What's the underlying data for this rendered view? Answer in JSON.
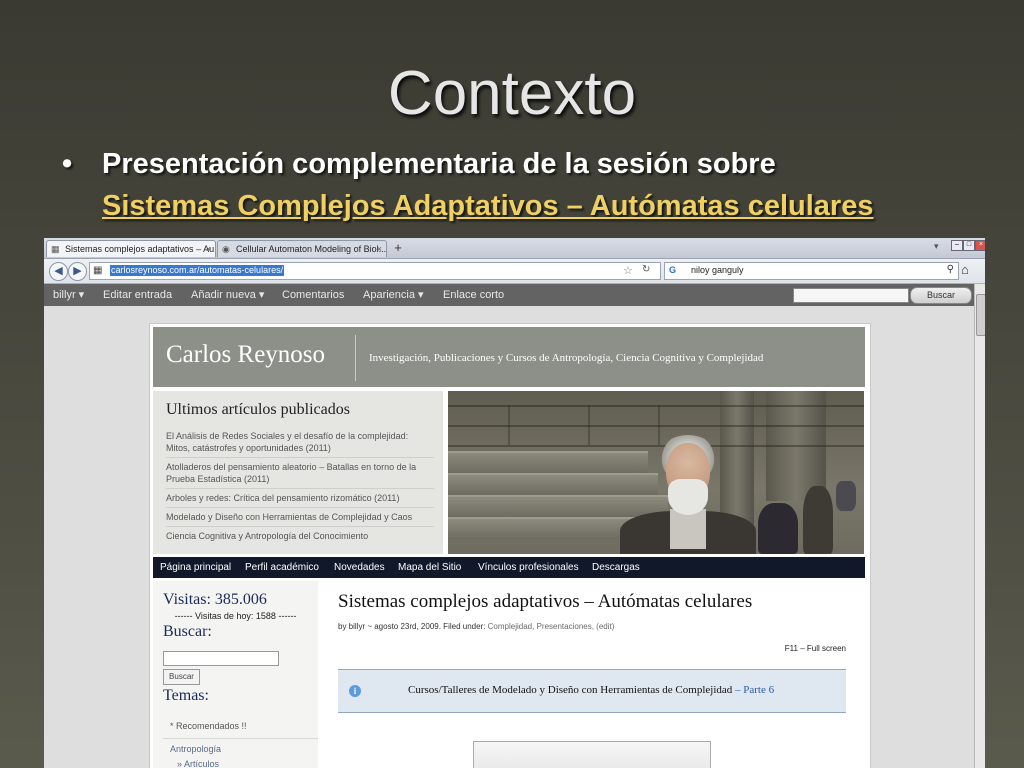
{
  "slide": {
    "title": "Contexto",
    "bullet": "•",
    "bullet_text": "Presentación complementaria de la sesión sobre",
    "bullet_link": "Sistemas Complejos Adaptativos – Autómatas celulares"
  },
  "browser": {
    "tabs": [
      {
        "label": "Sistemas complejos adaptativos – Au...",
        "close": "×"
      },
      {
        "label": "Cellular Automaton Modeling of Biol...",
        "close": "×"
      }
    ],
    "new_tab": "+",
    "url": "carlosreynoso.com.ar/automatas-celulares/",
    "search_engine": "G",
    "search_query": "niloy ganguly"
  },
  "admin_bar": {
    "items": [
      "billyr ▾",
      "Editar entrada",
      "Añadir nueva ▾",
      "Comentarios",
      "Apariencia ▾",
      "Enlace corto"
    ],
    "search_button": "Buscar"
  },
  "site": {
    "brand": "Carlos Reynoso",
    "tagline": "Investigación, Publicaciones y Cursos de Antropología, Ciencia Cognitiva y Complejidad",
    "recent_heading": "Ultimos artículos publicados",
    "recent_items": [
      "El Análisis de Redes Sociales y el desafío de la complejidad: Mitos, catástrofes y oportunidades (2011)",
      "Atolladeros del pensamiento aleatorio – Batallas en torno de la Prueba Estadística (2011)",
      "Arboles y redes: Crítica del pensamiento rizomático (2011)",
      "Modelado y Diseño con Herramientas de Complejidad y Caos",
      "Ciencia Cognitiva y Antropología del Conocimiento"
    ],
    "nav": [
      "Página principal",
      "Perfil académico",
      "Novedades",
      "Mapa del Sitio",
      "Vínculos profesionales",
      "Descargas"
    ],
    "sidebar": {
      "visits": "Visitas: 385.006",
      "visits_today": "------ Visitas de hoy: 1588 ------",
      "search_heading": "Buscar:",
      "search_button": "Buscar",
      "topics_heading": "Temas:",
      "recommended": "* Recomendados !!",
      "category": "Antropología",
      "subcategory": "» Artículos"
    },
    "post": {
      "title": "Sistemas complejos adaptativos – Autómatas celulares",
      "meta_prefix": "by billyr ~ agosto 23rd, 2009. Filed under: ",
      "meta_categories": "Complejidad, Presentaciones, (edit)",
      "fullscreen": "F11 – Full screen",
      "info_icon": "i",
      "info_text": "Cursos/Talleres de Modelado y Diseño con Herramientas de Complejidad",
      "info_link": " – Parte 6"
    }
  }
}
